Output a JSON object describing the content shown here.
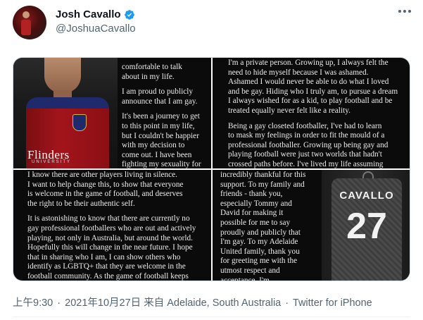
{
  "tweet": {
    "author_name": "Josh Cavallo",
    "author_handle": "@JoshuaCavallo",
    "verified": true,
    "more_icon": "ellipsis-icon"
  },
  "media": {
    "tile1": {
      "sponsor_text": "Flinders",
      "sponsor_sub": "UNIVERSITY",
      "paragraphs": [
        "comfortable to talk\nabout in my life.",
        "I am proud to publicly\nannounce that I am gay.",
        "It's been a journey to get\nto this point in my life,\nbut I couldn't be happier\nwith my decision to\ncome out. I have been\nfighting my sexuality for"
      ]
    },
    "tile2": {
      "paragraphs": [
        "I'm a private person. Growing up, I always felt the\nneed to hide myself because I was ashamed.\nAshamed I would never be able to do what I loved\nand be gay. Hiding who I truly am, to pursue a dream\nI always wished for as a kid, to play football and be\ntreated equally never felt like a reality.",
        "Being a gay closeted footballer, I've had to learn\nto mask my feelings in order to fit the mould of a\nprofessional footballer. Growing up being gay and\nplaying football were just two worlds that hadn't\ncrossed paths before. I've lived my life assuming"
      ]
    },
    "tile3": {
      "paragraphs": [
        "I know there are other players living in silence.\nI want to help change this, to show that everyone\nis welcome in the game of football, and deserves\nthe right to be their authentic self.",
        "It is astonishing to know that there are currently no\ngay professional footballers who are out and actively\nplaying, not only in Australia, but around the world.\nHopefully this will change in the near future. I hope\nthat in sharing who I am, I can show others who\nidentify as LGBTQ+ that they are welcome in the\nfootball community. As the game of football keeps"
      ]
    },
    "tile4": {
      "paragraphs": [
        "incredibly thankful for this\nsupport. To my family and\nfriends - thank you,\nespecially Tommy and\nDavid for making it\npossible for me to say\nproudly and publicly that\nI'm gay.  To my Adelaide\nUnited family, thank you\nfor greeting me with the\nutmost respect and\nacceptance. I'm"
      ],
      "jersey_name": "CAVALLO",
      "jersey_number": "27"
    }
  },
  "footer": {
    "time": "上午9:30",
    "date": "2021年10月27日",
    "location_prefix": "来自",
    "location": "Adelaide, South Australia",
    "source": "Twitter for iPhone",
    "separator": "·"
  }
}
